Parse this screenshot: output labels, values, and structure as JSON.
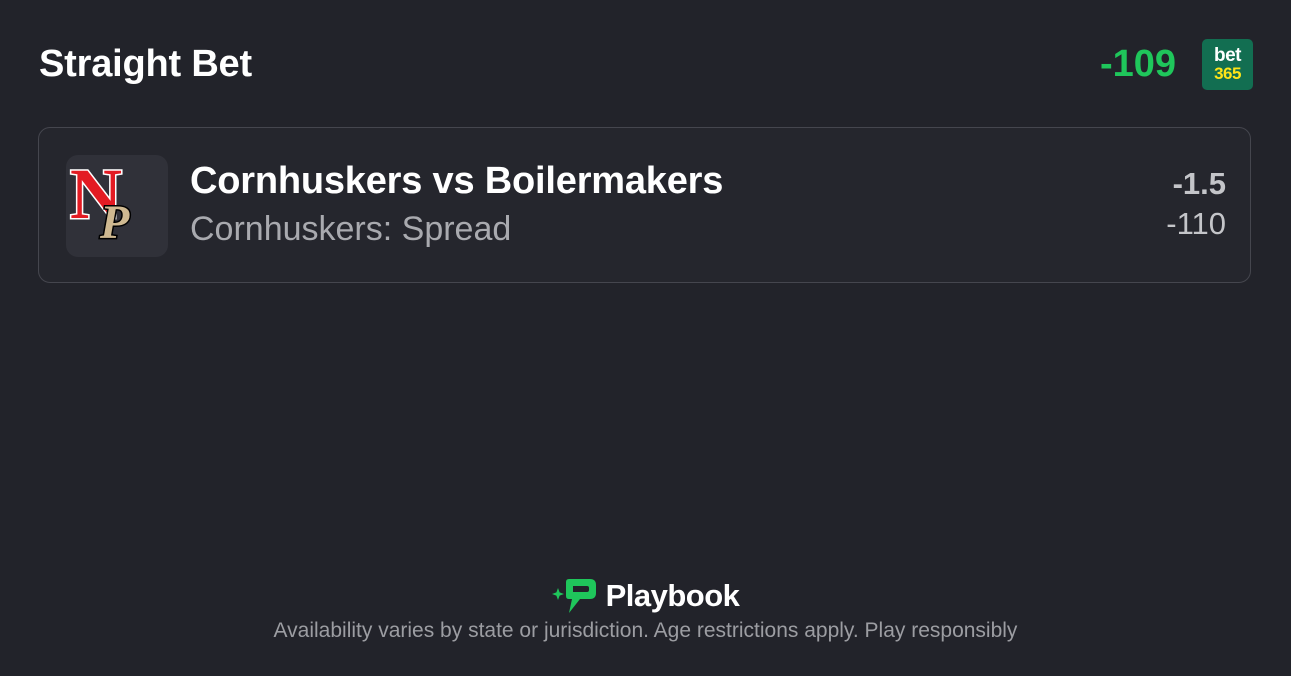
{
  "header": {
    "title": "Straight Bet",
    "odds": "-109",
    "sportsbook": {
      "logo_top": "bet",
      "logo_bottom": "365",
      "color": "#126e51"
    }
  },
  "bet": {
    "matchup": "Cornhuskers vs Boilermakers",
    "market": "Cornhuskers: Spread",
    "line": "-1.5",
    "price": "-110",
    "team_logos": {
      "home_letter": "N",
      "away_letter": "P"
    }
  },
  "footer": {
    "brand": "Playbook",
    "disclaimer": "Availability varies by state or jurisdiction. Age restrictions apply. Play responsibly"
  },
  "colors": {
    "background": "#22232a",
    "odds_green": "#1fc65b",
    "nebraska_red": "#e31b23",
    "purdue_gold": "#cfb991"
  }
}
